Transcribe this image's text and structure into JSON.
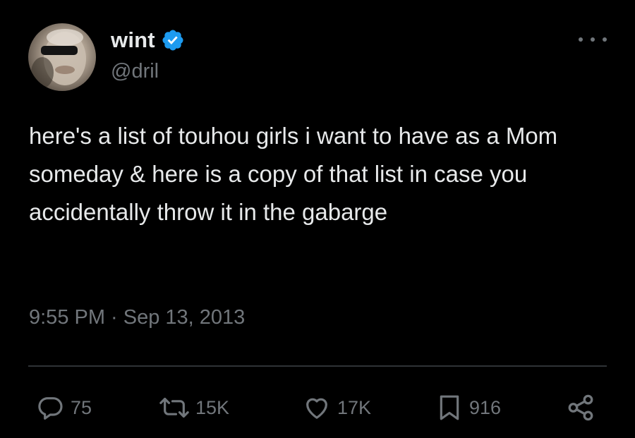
{
  "author": {
    "display_name": "wint",
    "handle": "@dril",
    "verified": true
  },
  "tweet": {
    "text": "here's a list of touhou girls i want to have as a Mom someday & here is a copy of that list in case you accidentally throw it in the gabarge",
    "timestamp": "9:55 PM · Sep 13, 2013"
  },
  "metrics": {
    "replies": "75",
    "retweets": "15K",
    "likes": "17K",
    "bookmarks": "916"
  },
  "icons": {
    "verified": "verified-badge-icon",
    "more": "more-options-icon",
    "reply": "reply-icon",
    "retweet": "retweet-icon",
    "like": "heart-icon",
    "bookmark": "bookmark-icon",
    "share": "share-icon"
  },
  "colors": {
    "background": "#000000",
    "primary_text": "#e7e9ea",
    "secondary_text": "#71767b",
    "verified_blue": "#1d9bf0",
    "divider": "#2f3336"
  }
}
